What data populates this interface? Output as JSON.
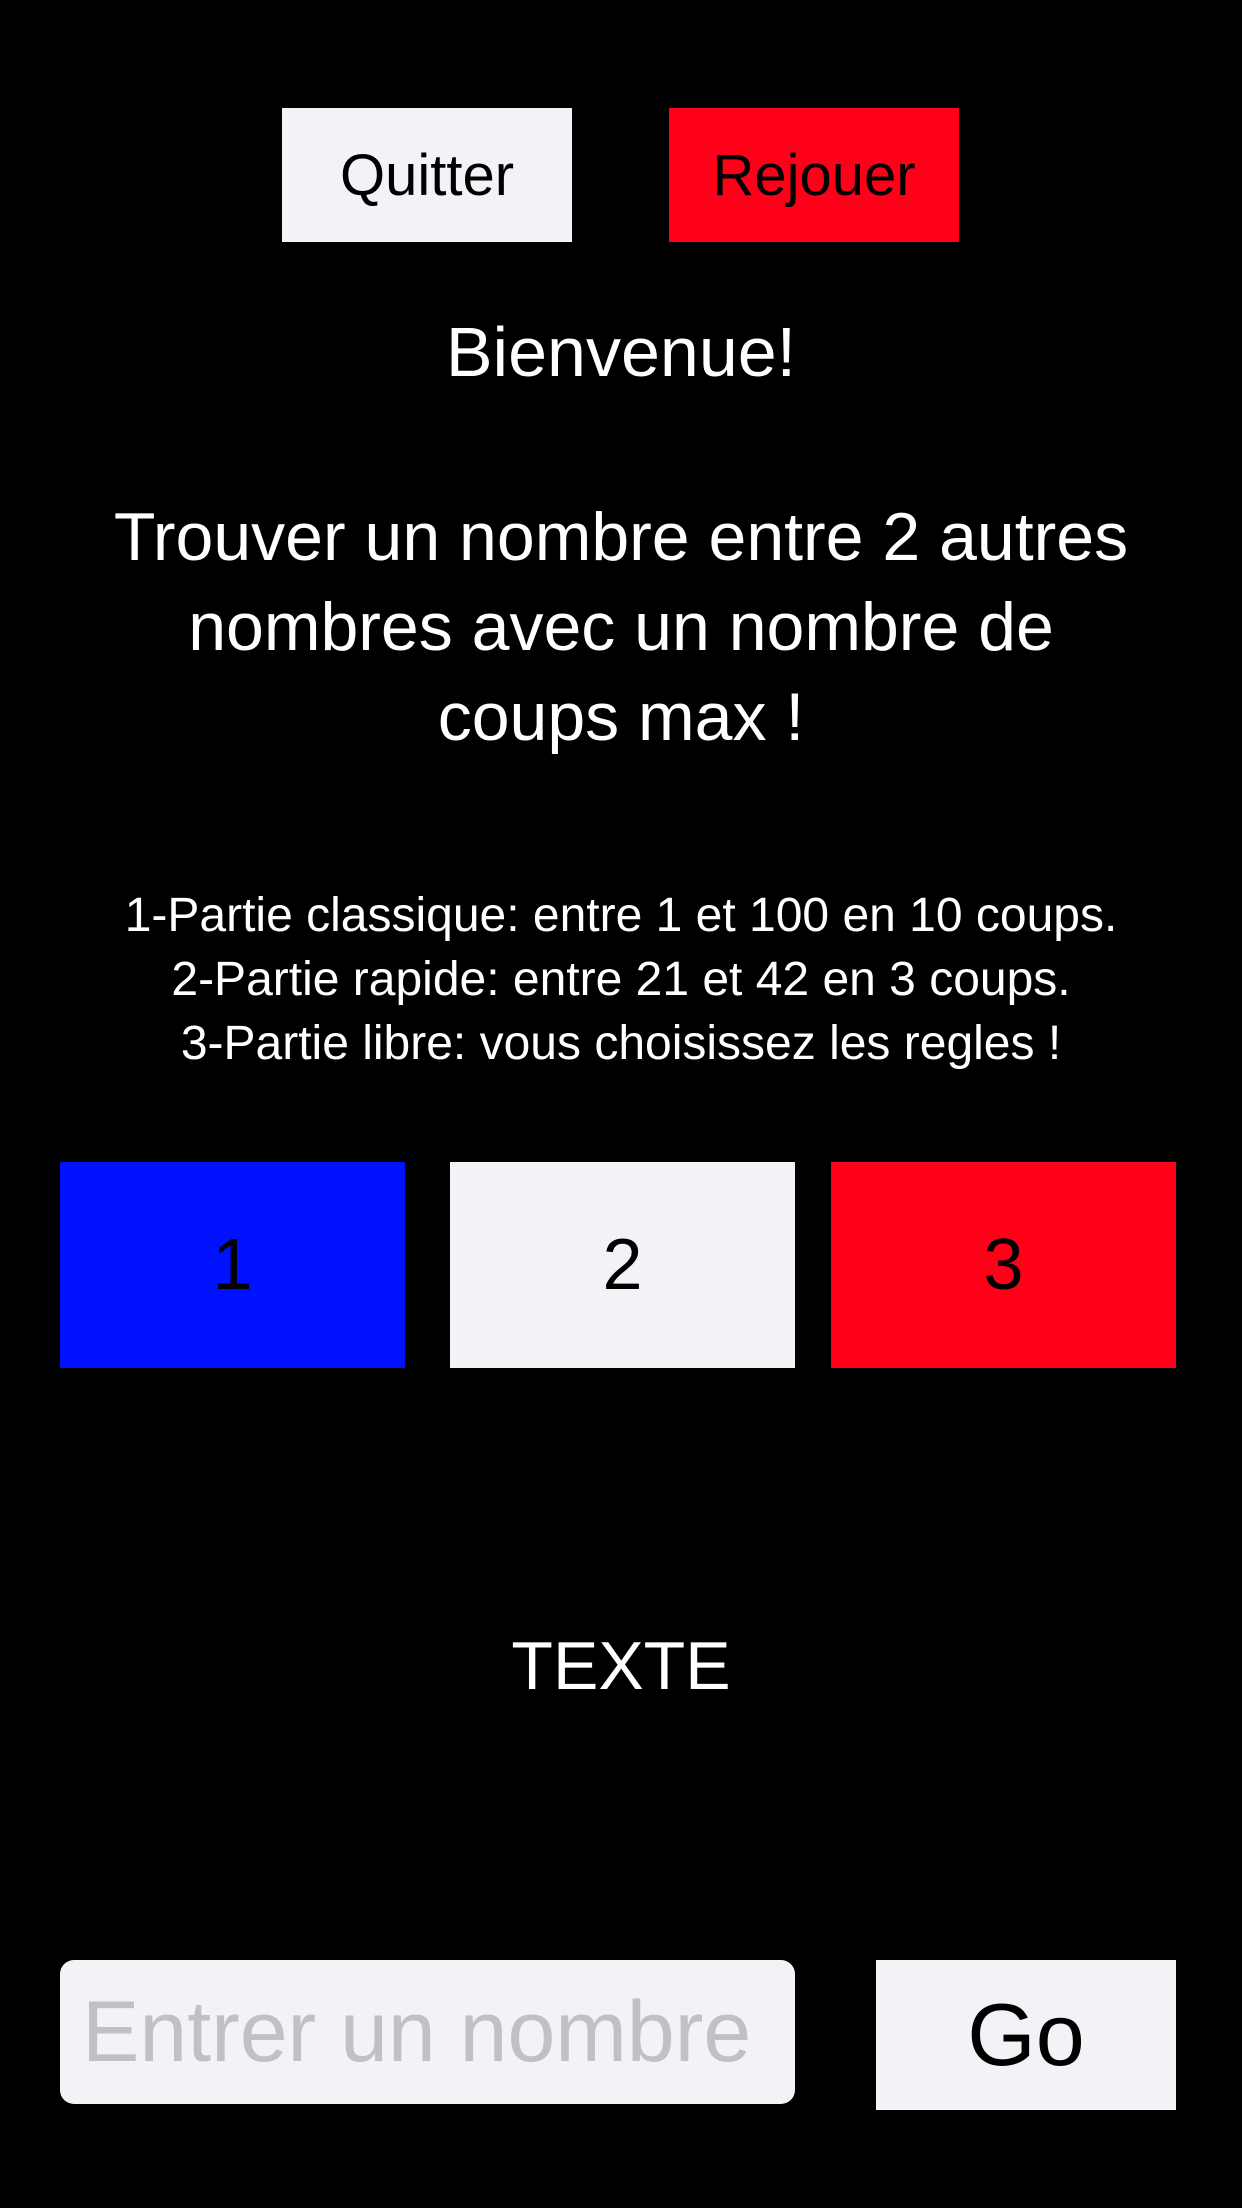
{
  "header": {
    "quit_label": "Quitter",
    "replay_label": "Rejouer"
  },
  "main": {
    "welcome": "Bienvenue!",
    "subtitle_lines": [
      "Trouver un nombre entre 2 autres",
      "nombres avec un nombre de",
      "coups max !"
    ],
    "rules": [
      "1-Partie classique: entre 1 et 100 en 10 coups.",
      "2-Partie rapide: entre 21 et 42 en 3 coups.",
      "3-Partie libre: vous choisissez les regles !"
    ],
    "modes": [
      {
        "label": "1",
        "color": "#0011ff"
      },
      {
        "label": "2",
        "color": "#f2f2f7"
      },
      {
        "label": "3",
        "color": "#ff0019"
      }
    ],
    "status_text": "TEXTE"
  },
  "footer": {
    "input_placeholder": "Entrer un nombre",
    "input_value": "",
    "go_label": "Go"
  },
  "colors": {
    "background": "#000000",
    "light_button": "#f2f2f7",
    "red_button": "#ff0019",
    "blue_button": "#0011ff",
    "text": "#ffffff"
  }
}
